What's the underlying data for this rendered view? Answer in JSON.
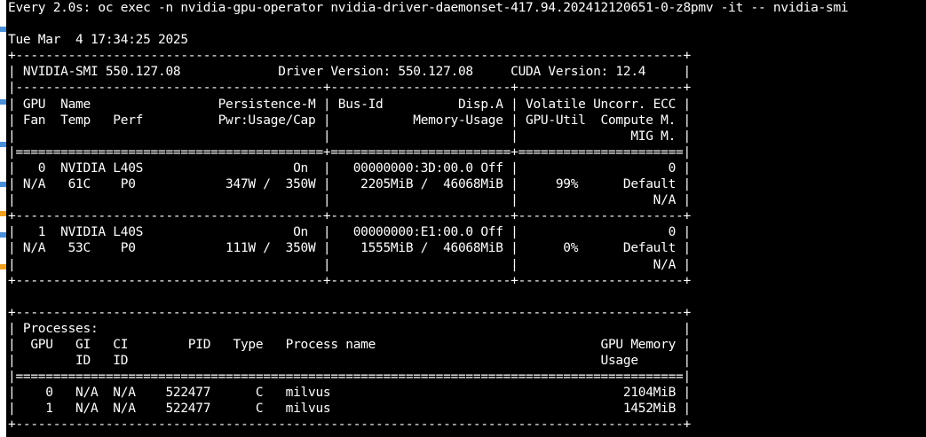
{
  "header": {
    "watch_line": "Every 2.0s: oc exec -n nvidia-gpu-operator nvidia-driver-daemonset-417.94.202412120651-0-z8pmv -it -- nvidia-smi",
    "timestamp": "Tue Mar  4 17:34:25 2025"
  },
  "output_lines": [
    "+-----------------------------------------------------------------------------------------+",
    "| NVIDIA-SMI 550.127.08             Driver Version: 550.127.08     CUDA Version: 12.4     |",
    "|-----------------------------------------+------------------------+----------------------+",
    "| GPU  Name                 Persistence-M | Bus-Id          Disp.A | Volatile Uncorr. ECC |",
    "| Fan  Temp   Perf          Pwr:Usage/Cap |           Memory-Usage | GPU-Util  Compute M. |",
    "|                                         |                        |               MIG M. |",
    "|=========================================+========================+======================|",
    "|   0  NVIDIA L40S                    On  |   00000000:3D:00.0 Off |                    0 |",
    "| N/A   61C    P0            347W /  350W |    2205MiB /  46068MiB |     99%      Default |",
    "|                                         |                        |                  N/A |",
    "+-----------------------------------------+------------------------+----------------------+",
    "|   1  NVIDIA L40S                    On  |   00000000:E1:00.0 Off |                    0 |",
    "| N/A   53C    P0            111W /  350W |    1555MiB /  46068MiB |      0%      Default |",
    "|                                         |                        |                  N/A |",
    "+-----------------------------------------+------------------------+----------------------+",
    "",
    "+-----------------------------------------------------------------------------------------+",
    "| Processes:                                                                              |",
    "|  GPU   GI   CI        PID   Type   Process name                              GPU Memory |",
    "|        ID   ID                                                               Usage      |",
    "|=========================================================================================|",
    "|    0   N/A  N/A    522477      C   milvus                                       2104MiB |",
    "|    1   N/A  N/A    522477      C   milvus                                       1452MiB |",
    "+-----------------------------------------------------------------------------------------+"
  ]
}
